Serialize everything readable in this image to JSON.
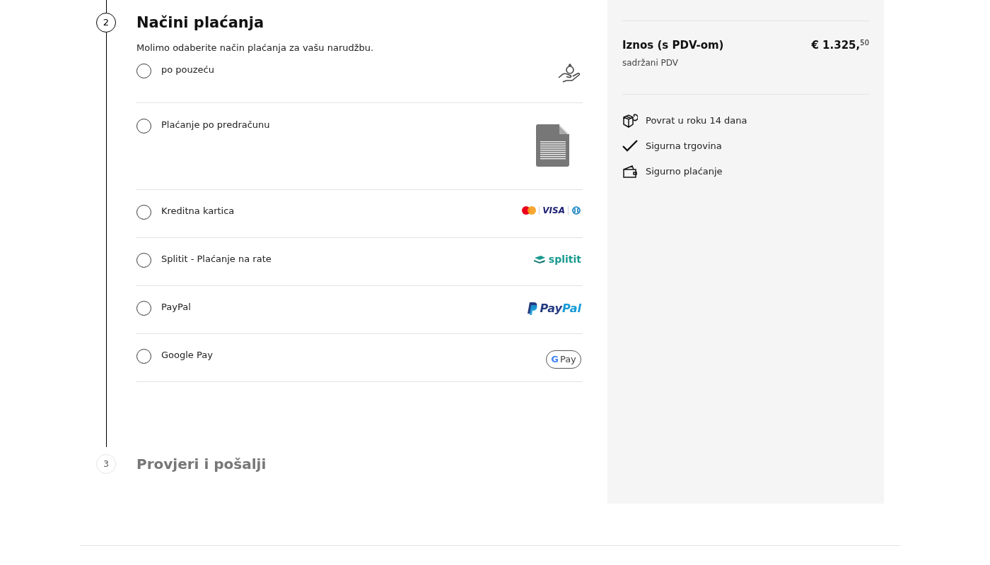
{
  "steps": [
    {
      "number": "2",
      "title": "Načini plaćanja",
      "active": true,
      "intro": "Molimo odaberite način plaćanja za vašu narudžbu.",
      "methods": [
        {
          "label": "po pouzeću",
          "selected": false,
          "kind": "cod"
        },
        {
          "label": "Plaćanje po predračunu",
          "selected": false,
          "kind": "invoice"
        },
        {
          "label": "Kreditna kartica",
          "selected": false,
          "kind": "card",
          "logo_text": [
            "VISA"
          ]
        },
        {
          "label": "Splitit - Plaćanje na rate",
          "selected": false,
          "kind": "splitit",
          "logo_text": [
            "splitit"
          ]
        },
        {
          "label": "PayPal",
          "selected": false,
          "kind": "paypal",
          "logo_text": [
            "Pay",
            "Pal"
          ]
        },
        {
          "label": "Google Pay",
          "selected": false,
          "kind": "gpay",
          "logo_text": [
            "G",
            "Pay"
          ]
        }
      ]
    },
    {
      "number": "3",
      "title": "Provjeri i pošalji",
      "active": false
    }
  ],
  "summary": {
    "total_label": "Iznos (s PDV-om)",
    "total_value": "€ 1.325,",
    "total_cents": "50",
    "vat_note": "sadržani PDV",
    "features": [
      {
        "kind": "return",
        "text": "Povrat u roku 14 dana"
      },
      {
        "kind": "check",
        "text": "Sigurna trgovina"
      },
      {
        "kind": "wallet",
        "text": "Sigurno plaćanje"
      }
    ]
  }
}
